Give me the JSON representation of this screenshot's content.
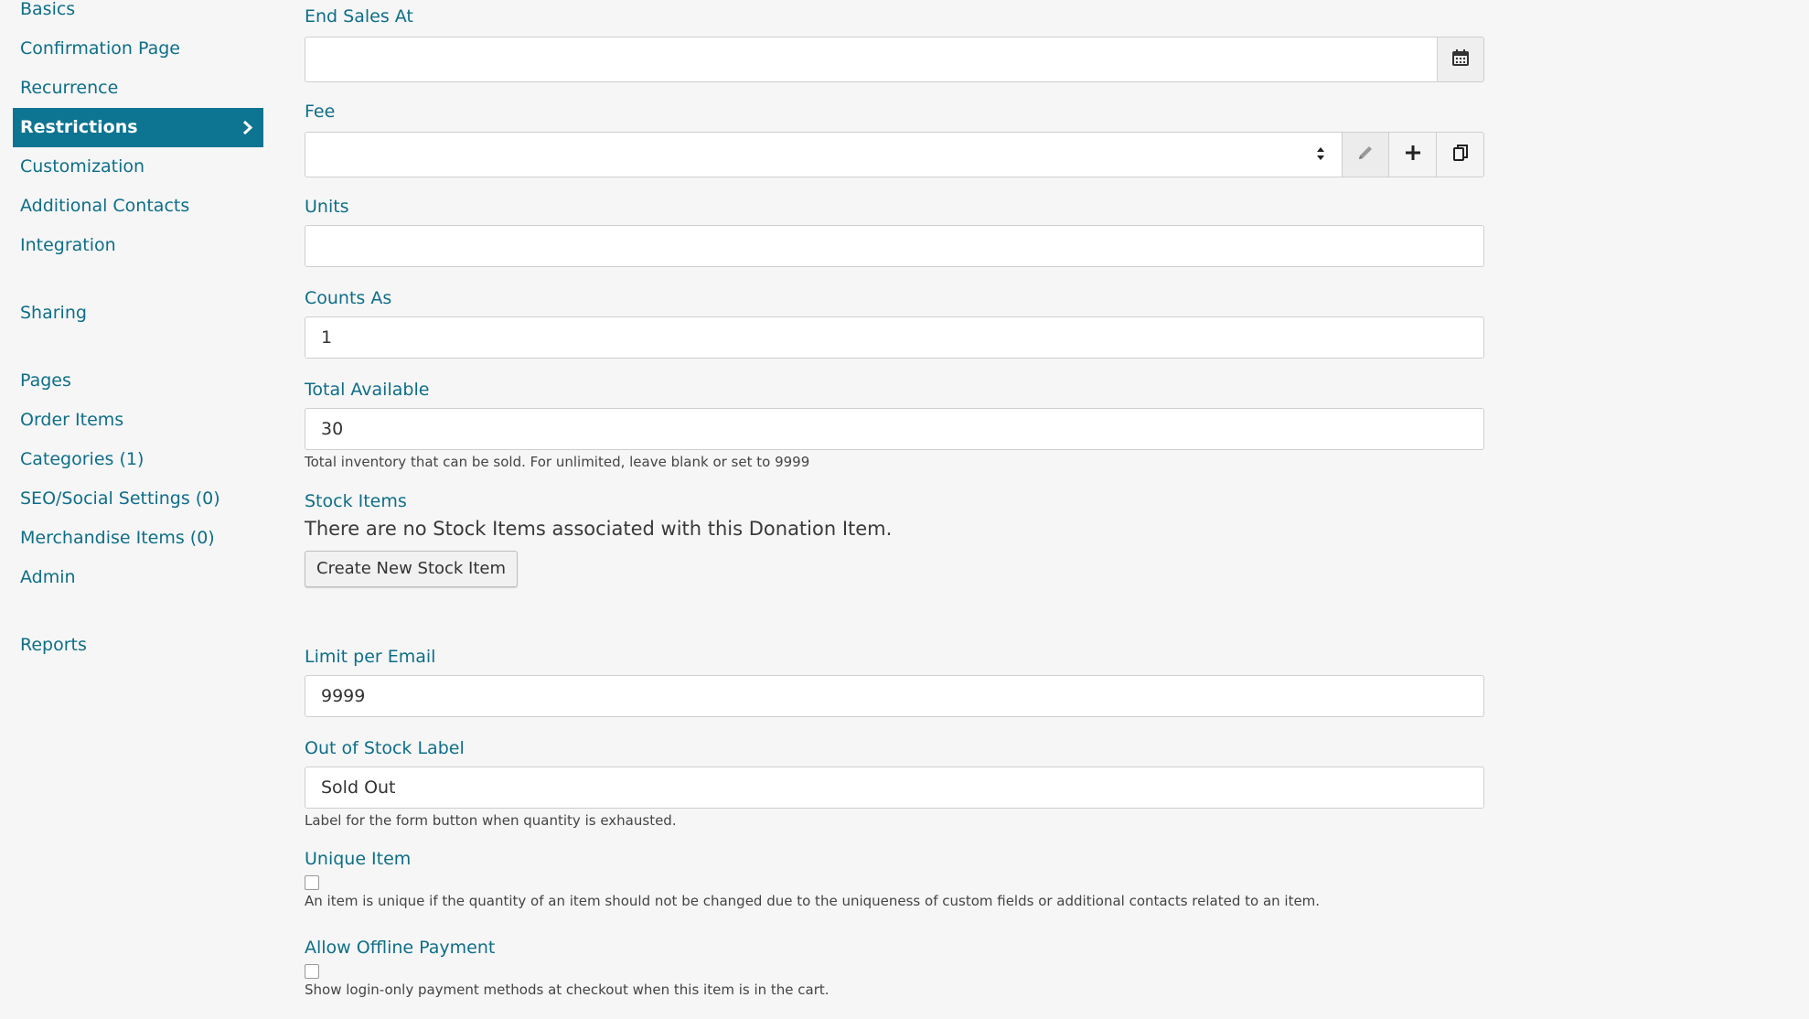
{
  "sidebar": {
    "items": [
      {
        "label": "Basics"
      },
      {
        "label": "Confirmation Page"
      },
      {
        "label": "Recurrence"
      },
      {
        "label": "Restrictions"
      },
      {
        "label": "Customization"
      },
      {
        "label": "Additional Contacts"
      },
      {
        "label": "Integration"
      },
      {
        "label": "Sharing"
      },
      {
        "label": "Pages"
      },
      {
        "label": "Order Items"
      },
      {
        "label": "Categories (1)"
      },
      {
        "label": "SEO/Social Settings (0)"
      },
      {
        "label": "Merchandise Items (0)"
      },
      {
        "label": "Admin"
      },
      {
        "label": "Reports"
      }
    ],
    "active_item": "Restrictions",
    "active_color": "#0d7491"
  },
  "form": {
    "end_sales_at": {
      "label": "End Sales At",
      "value": ""
    },
    "fee": {
      "label": "Fee",
      "value": ""
    },
    "units": {
      "label": "Units",
      "value": ""
    },
    "counts_as": {
      "label": "Counts As",
      "value": "1"
    },
    "total_available": {
      "label": "Total Available",
      "value": "30",
      "help": "Total inventory that can be sold. For unlimited, leave blank or set to 9999"
    },
    "stock_items": {
      "label": "Stock Items",
      "message": "There are no Stock Items associated with this Donation Item.",
      "button": "Create New Stock Item"
    },
    "limit_per_email": {
      "label": "Limit per Email",
      "value": "9999"
    },
    "out_of_stock_label": {
      "label": "Out of Stock Label",
      "value": "Sold Out",
      "help": "Label for the form button when quantity is exhausted."
    },
    "unique_item": {
      "label": "Unique Item",
      "checked": false,
      "help": "An item is unique if the quantity of an item should not be changed due to the uniqueness of custom fields or additional contacts related to an item."
    },
    "allow_offline_payment": {
      "label": "Allow Offline Payment",
      "checked": false,
      "help": "Show login-only payment methods at checkout when this item is in the cart."
    }
  },
  "icons": {
    "calendar": "calendar-icon",
    "edit": "pencil-icon",
    "add": "plus-icon",
    "copy": "copy-icon",
    "active_chevron": "chevron-right-icon"
  }
}
